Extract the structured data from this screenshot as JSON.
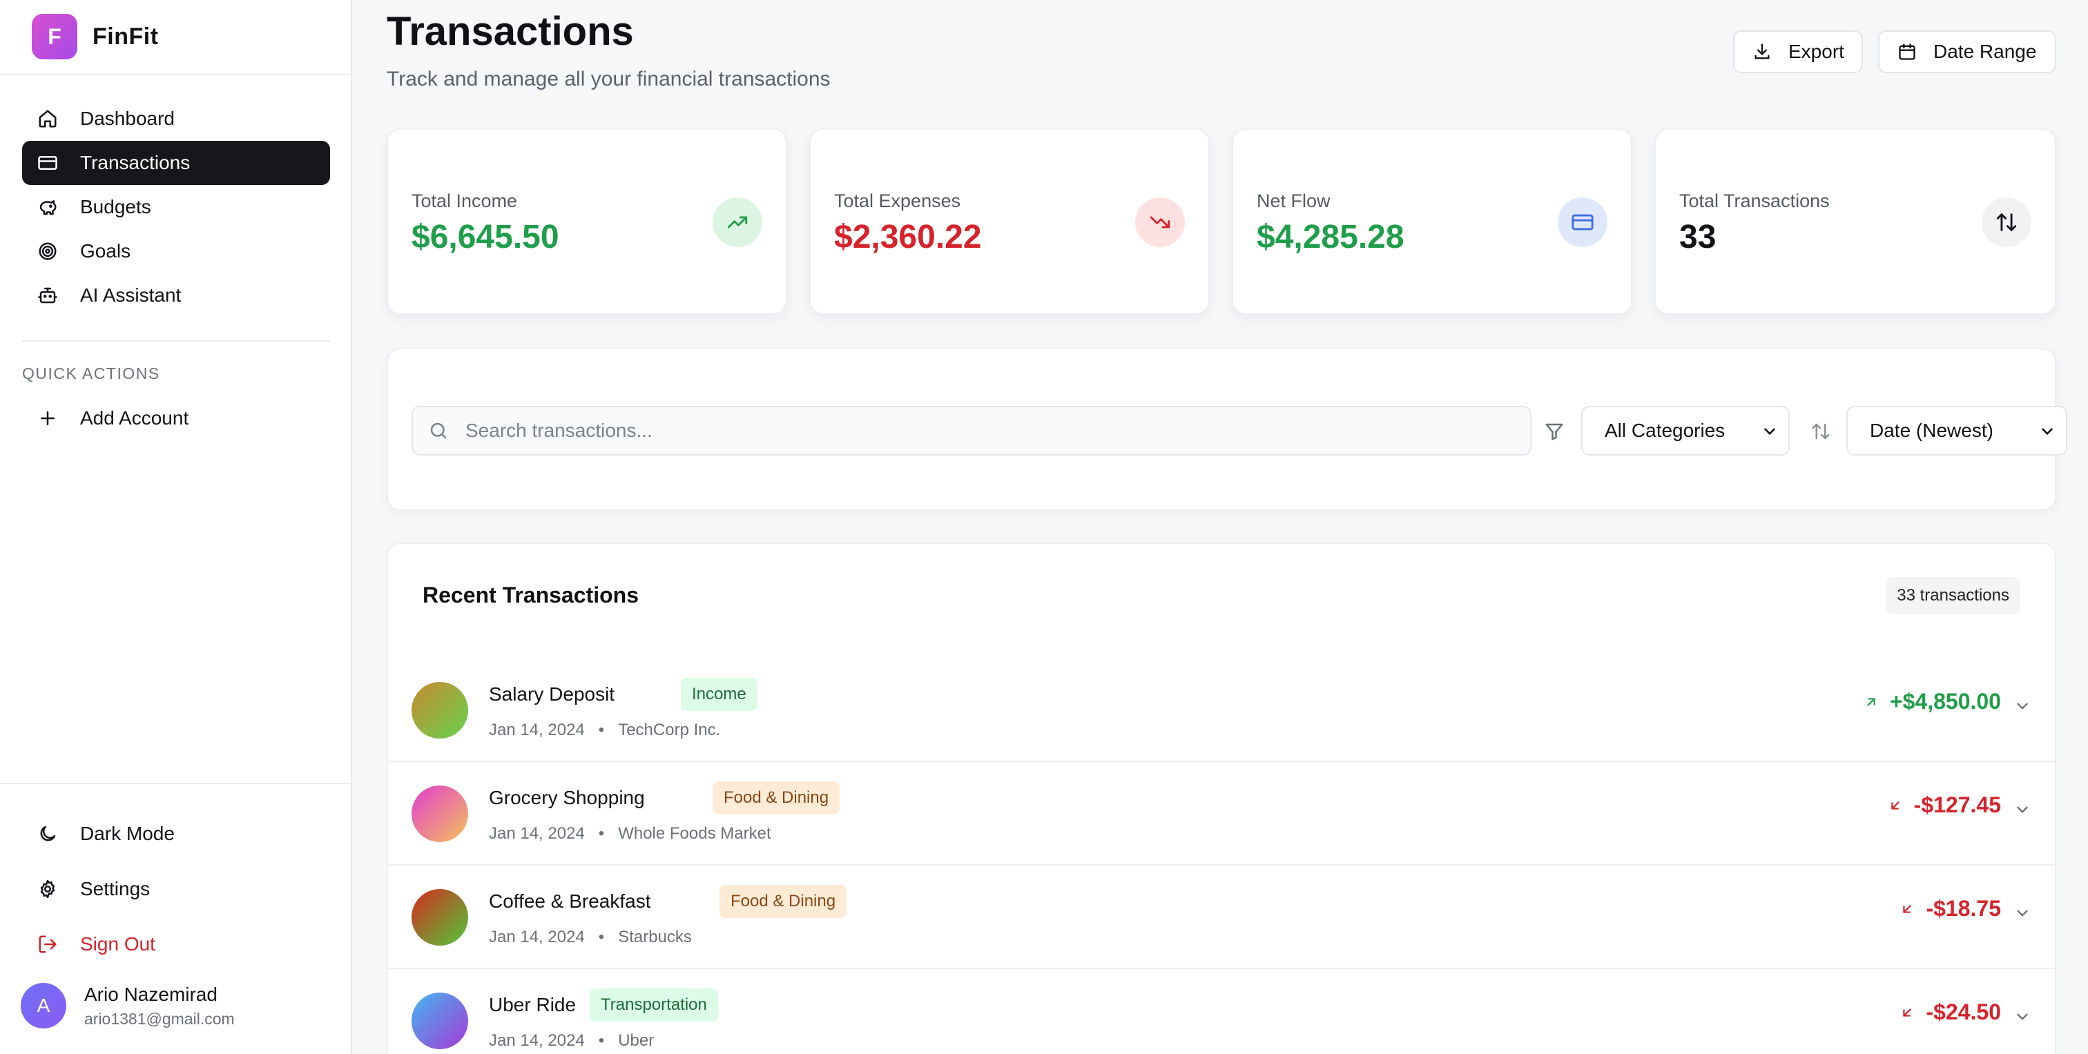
{
  "brand": {
    "logo_letter": "F",
    "name": "FinFit"
  },
  "nav": {
    "items": [
      {
        "label": "Dashboard",
        "icon": "home-icon",
        "active": false
      },
      {
        "label": "Transactions",
        "icon": "credit-card-icon",
        "active": true
      },
      {
        "label": "Budgets",
        "icon": "piggy-bank-icon",
        "active": false
      },
      {
        "label": "Goals",
        "icon": "target-icon",
        "active": false
      },
      {
        "label": "AI Assistant",
        "icon": "bot-icon",
        "active": false
      }
    ]
  },
  "quick_actions": {
    "label": "QUICK ACTIONS",
    "items": [
      {
        "label": "Add Account",
        "icon": "plus-icon"
      }
    ]
  },
  "bottom_nav": {
    "dark_mode": "Dark Mode",
    "settings": "Settings",
    "sign_out": "Sign Out"
  },
  "user": {
    "initial": "A",
    "name": "Ario Nazemirad",
    "email": "ario1381@gmail.com"
  },
  "header": {
    "title": "Transactions",
    "subtitle": "Track and manage all your financial transactions",
    "export_label": "Export",
    "date_range_label": "Date Range"
  },
  "stats": {
    "income": {
      "label": "Total Income",
      "value": "$6,645.50",
      "color": "#1f9e4a"
    },
    "expenses": {
      "label": "Total Expenses",
      "value": "$2,360.22",
      "color": "#d6232b"
    },
    "net": {
      "label": "Net Flow",
      "value": "$4,285.28",
      "color": "#1f9e4a"
    },
    "count": {
      "label": "Total Transactions",
      "value": "33",
      "color": "#111317"
    }
  },
  "filters": {
    "search_placeholder": "Search transactions...",
    "category_selected": "All Categories",
    "sort_selected": "Date (Newest)"
  },
  "transactions": {
    "title": "Recent Transactions",
    "count_label": "33 transactions",
    "rows": [
      {
        "name": "Salary Deposit",
        "category": "Income",
        "date": "Jan 14, 2024",
        "merchant": "TechCorp Inc.",
        "amount": "+$4,850.00"
      },
      {
        "name": "Grocery Shopping",
        "category": "Food & Dining",
        "date": "Jan 14, 2024",
        "merchant": "Whole Foods Market",
        "amount": "-$127.45"
      },
      {
        "name": "Coffee & Breakfast",
        "category": "Food & Dining",
        "date": "Jan 14, 2024",
        "merchant": "Starbucks",
        "amount": "-$18.75"
      },
      {
        "name": "Uber Ride",
        "category": "Transportation",
        "date": "Jan 14, 2024",
        "merchant": "Uber",
        "amount": "-$24.50"
      }
    ]
  },
  "colors": {
    "accent_dark": "#16171a",
    "income_green": "#1f9e4a",
    "expense_red": "#d6232b",
    "net_blue": "#3b6fe0"
  }
}
